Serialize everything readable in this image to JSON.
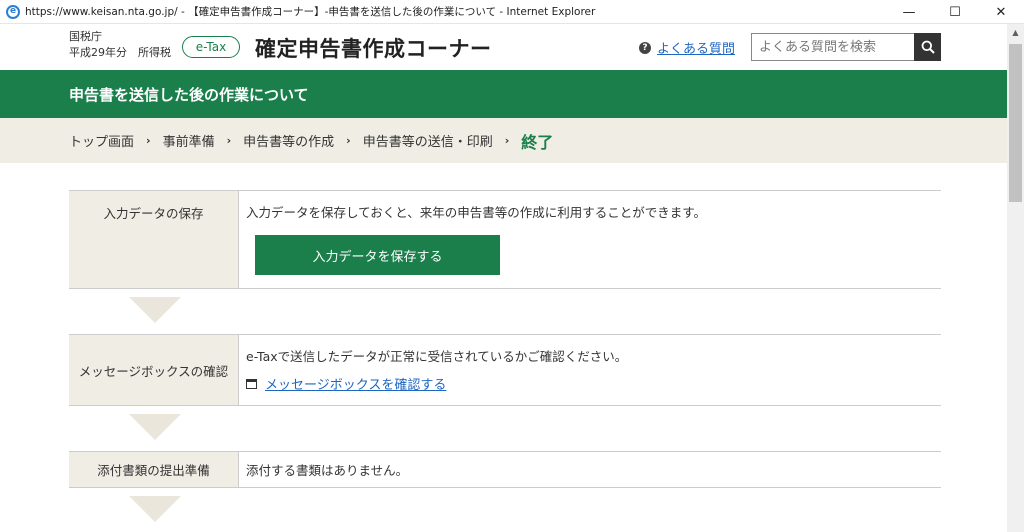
{
  "window": {
    "title": "https://www.keisan.nta.go.jp/ - 【確定申告書作成コーナー】-申告書を送信した後の作業について - Internet Explorer",
    "icon": "ie-logo-icon",
    "controls": {
      "minimize": "—",
      "maximize": "☐",
      "close": "✕"
    }
  },
  "header": {
    "agency": "国税庁",
    "year_line": "平成29年分　所得税",
    "etax_badge": "e-Tax",
    "site_title": "確定申告書作成コーナー",
    "faq_link": "よくある質問",
    "faq_icon": "?",
    "search": {
      "placeholder": "よくある質問を検索",
      "value": ""
    }
  },
  "banner": {
    "title": "申告書を送信した後の作業について"
  },
  "breadcrumb": {
    "items": [
      "トップ画面",
      "事前準備",
      "申告書等の作成",
      "申告書等の送信・印刷"
    ],
    "current": "終了",
    "separator": "›"
  },
  "steps": [
    {
      "label": "入力データの保存",
      "text": "入力データを保存しておくと、来年の申告書等の作成に利用することができます。",
      "button": "入力データを保存する"
    },
    {
      "label": "メッセージボックスの確認",
      "text": "e-Taxで送信したデータが正常に受信されているかご確認ください。",
      "link": "メッセージボックスを確認する"
    },
    {
      "label": "添付書類の提出準備",
      "text": "添付する書類はありません。"
    }
  ],
  "colors": {
    "brand_green": "#1a7f4b",
    "beige": "#f0ede4",
    "link_blue": "#1d66c2"
  }
}
